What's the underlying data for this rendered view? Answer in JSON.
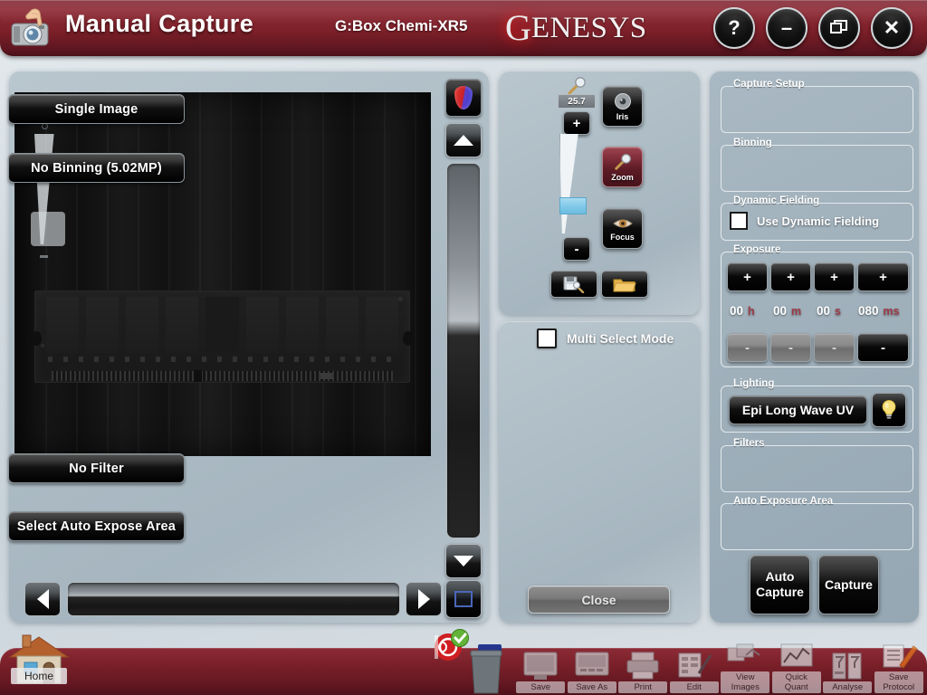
{
  "titlebar": {
    "app_icon": "camera-hand-icon",
    "title": "Manual Capture",
    "device": "G:Box Chemi-XR5",
    "brand_first": "G",
    "brand_rest": "ENESYS",
    "buttons": [
      {
        "name": "help-button",
        "glyph": "?"
      },
      {
        "name": "minimize-button",
        "glyph": "–"
      },
      {
        "name": "restore-button",
        "glyph": "❐"
      },
      {
        "name": "close-button",
        "glyph": "✕"
      }
    ],
    "accent_color": "#7d2029"
  },
  "image_panel": {
    "color_button_icon": "color-droplet-icon",
    "scroll_up_icon": "triangle-up-icon",
    "scroll_down_icon": "triangle-down-icon",
    "scroll_left_icon": "triangle-left-icon",
    "scroll_right_icon": "triangle-right-icon",
    "fit_button_icon": "fit-to-window-icon",
    "overlay_name": "measurement-overlay"
  },
  "camera_panel": {
    "zoom_value": "25.7",
    "magnifier_icon": "magnifier-icon",
    "zoom_plus": "+",
    "zoom_minus": "-",
    "buttons": [
      {
        "name": "iris-button",
        "label": "Iris",
        "icon": "iris-aperture-icon",
        "active": false
      },
      {
        "name": "zoom-button",
        "label": "Zoom",
        "icon": "magnifier-icon",
        "active": true
      },
      {
        "name": "focus-button",
        "label": "Focus",
        "icon": "eye-icon",
        "active": false
      }
    ],
    "save_find_icon": "save-search-icon",
    "open_icon": "open-folder-icon"
  },
  "select_panel": {
    "multi_select_label": "Multi Select Mode",
    "multi_select_checked": false,
    "close_label": "Close"
  },
  "settings": {
    "capture_setup": {
      "legend": "Capture Setup",
      "value": "Single Image"
    },
    "binning": {
      "legend": "Binning",
      "value": "No Binning (5.02MP)"
    },
    "dynamic_fielding": {
      "legend": "Dynamic Fielding",
      "label": "Use Dynamic Fielding",
      "checked": false
    },
    "exposure": {
      "legend": "Exposure",
      "plus_label": "+",
      "minus_label": "-",
      "fields": [
        {
          "name": "hours",
          "value": "00",
          "unit": "h",
          "minus_enabled": false
        },
        {
          "name": "minutes",
          "value": "00",
          "unit": "m",
          "minus_enabled": false
        },
        {
          "name": "seconds",
          "value": "00",
          "unit": "s",
          "minus_enabled": false
        },
        {
          "name": "milliseconds",
          "value": "080",
          "unit": "ms",
          "minus_enabled": true
        }
      ]
    },
    "lighting": {
      "legend": "Lighting",
      "value": "Epi Long Wave UV",
      "lamp_icon": "lightbulb-icon"
    },
    "filters": {
      "legend": "Filters",
      "value": "No Filter"
    },
    "auto_exposure_area": {
      "legend": "Auto Exposure Area",
      "value": "Select Auto Expose Area"
    },
    "auto_capture_label": "Auto\nCapture",
    "auto_capture_line1": "Auto",
    "auto_capture_line2": "Capture",
    "capture_label": "Capture"
  },
  "bottom_bar": {
    "home_label": "Home",
    "home_icon": "house-icon",
    "status_icon": "capture-ok-icon",
    "trash_icon": "trash-bin-icon",
    "tools": [
      {
        "name": "save-tool",
        "label": "Save",
        "icon": "floppy-monitor-icon"
      },
      {
        "name": "save-as-tool",
        "label": "Save As",
        "icon": "save-as-icon"
      },
      {
        "name": "print-tool",
        "label": "Print",
        "icon": "printer-icon"
      },
      {
        "name": "edit-tool",
        "label": "Edit",
        "icon": "pencil-form-icon"
      },
      {
        "name": "view-images-tool",
        "label": "View\nImages",
        "icon": "images-icon",
        "line1": "View",
        "line2": "Images"
      },
      {
        "name": "quick-quant-tool",
        "label": "Quick\nQuant",
        "icon": "chart-icon",
        "line1": "Quick",
        "line2": "Quant"
      },
      {
        "name": "analyse-tool",
        "label": "Analyse",
        "icon": "analysis-icon"
      },
      {
        "name": "save-protocol-tool",
        "label": "Save\nProtocol",
        "icon": "document-pencil-icon",
        "line1": "Save",
        "line2": "Protocol"
      }
    ]
  }
}
